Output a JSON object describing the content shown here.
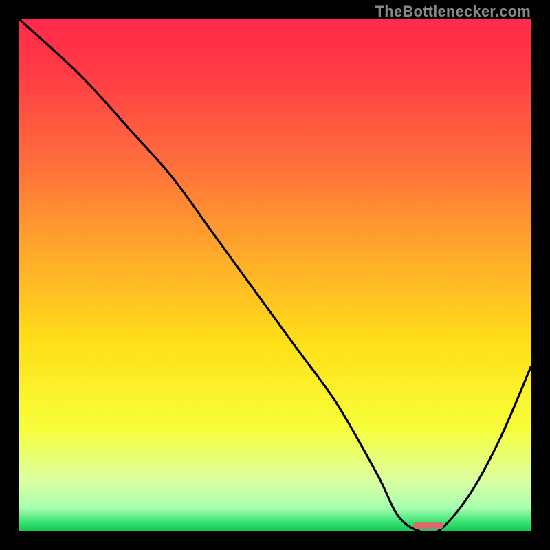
{
  "watermark": {
    "text": "TheBottlenecker.com"
  },
  "chart_data": {
    "type": "line",
    "title": "",
    "xlabel": "",
    "ylabel": "",
    "xlim": [
      0,
      100
    ],
    "ylim": [
      0,
      100
    ],
    "series": [
      {
        "name": "curve",
        "x": [
          0,
          12,
          22,
          30,
          38,
          46,
          54,
          62,
          70,
          74,
          78,
          82,
          88,
          94,
          100
        ],
        "y": [
          100,
          89,
          78,
          69,
          58,
          47,
          36,
          25,
          11,
          3,
          0,
          0,
          7,
          18,
          32
        ]
      }
    ],
    "marker": {
      "x": 80,
      "y": 1,
      "width": 6,
      "height": 1.2,
      "color": "#dd6a6a"
    },
    "grid": false,
    "legend": false,
    "gradient_stops": [
      {
        "pos": 0.0,
        "color": "#ff2a4a"
      },
      {
        "pos": 0.1,
        "color": "#ff3a46"
      },
      {
        "pos": 0.28,
        "color": "#ff6e3c"
      },
      {
        "pos": 0.48,
        "color": "#ffb028"
      },
      {
        "pos": 0.64,
        "color": "#ffe119"
      },
      {
        "pos": 0.8,
        "color": "#f7ff3a"
      },
      {
        "pos": 0.9,
        "color": "#dcffa0"
      },
      {
        "pos": 0.955,
        "color": "#a8ffb0"
      },
      {
        "pos": 0.985,
        "color": "#34e070"
      },
      {
        "pos": 1.0,
        "color": "#14c956"
      }
    ]
  }
}
